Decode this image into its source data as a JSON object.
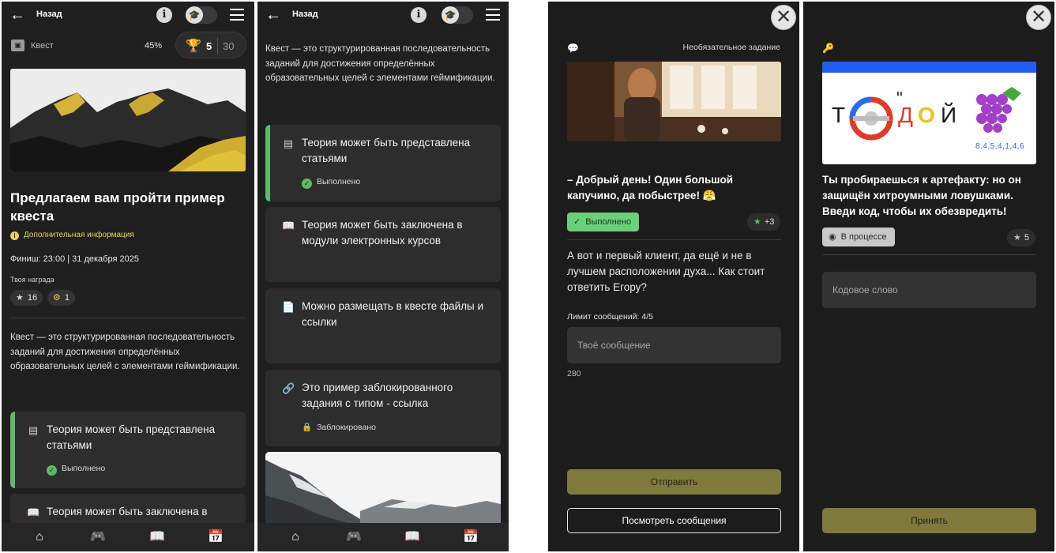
{
  "header": {
    "back_label": "Назад"
  },
  "quest": {
    "label": "Квест",
    "progress_percent": "45%",
    "trophies_done": "5",
    "trophies_total": "30",
    "title": "Предлагаем вам пройти пример квеста",
    "additional_info": "Дополнительная информация",
    "finish": "Финиш: 23:00 | 31 декабря 2025",
    "reward_label": "Твоя награда",
    "reward_stars": "16",
    "reward_coins": "1",
    "description": "Квест — это структурированная последовательность заданий для достижения определённых образовательных целей с элементами геймификации."
  },
  "tasks": [
    {
      "text": "Теория может быть представлена статьями",
      "icon": "article-icon",
      "status": "Выполнено"
    },
    {
      "text": "Теория может быть заключена в модули электронных курсов",
      "icon": "book-icon",
      "status": ""
    },
    {
      "text": "Можно размещать в квесте файлы и ссылки",
      "icon": "file-icon",
      "status": ""
    },
    {
      "text": "Это пример заблокированного задания с типом - ссылка",
      "icon": "link-icon",
      "status": "Заблокировано"
    }
  ],
  "nav": [
    "home-icon",
    "gamepad-icon",
    "book-icon",
    "calendar-icon"
  ],
  "task_chat": {
    "optional_label": "Необязательное задание",
    "greeting": "– Добрый день! Один большой капучино, да побыстрее! 😤",
    "status": "Выполнено",
    "points": "+3",
    "question": "А вот и первый клиент, да ещё и не в лучшем расположении духа... Как стоит ответить Егору?",
    "limit": "Лимит сообщений: 4/5",
    "placeholder": "Твоё сообщение",
    "counter": "280",
    "send_button": "Отправить",
    "view_button": "Посмотреть сообщения"
  },
  "task_code": {
    "artifact_text": "Ты пробираешься к артефакту: но он защищён хитроумными ловушками. Введи код, чтобы их обезвредить!",
    "status": "В процессе",
    "points": "5",
    "placeholder": "Кодовое слово",
    "accept_button": "Принять",
    "puzzle_letters": [
      "Т",
      "Д",
      "О",
      "Й"
    ],
    "puzzle_numbers": "8,4,5,4,1,4,6",
    "puzzle_accent": "#2a6af0"
  },
  "colors": {
    "accent_green": "#5dbb68",
    "olive": "#7f7a3c",
    "yellow_info": "#e6d35a"
  }
}
